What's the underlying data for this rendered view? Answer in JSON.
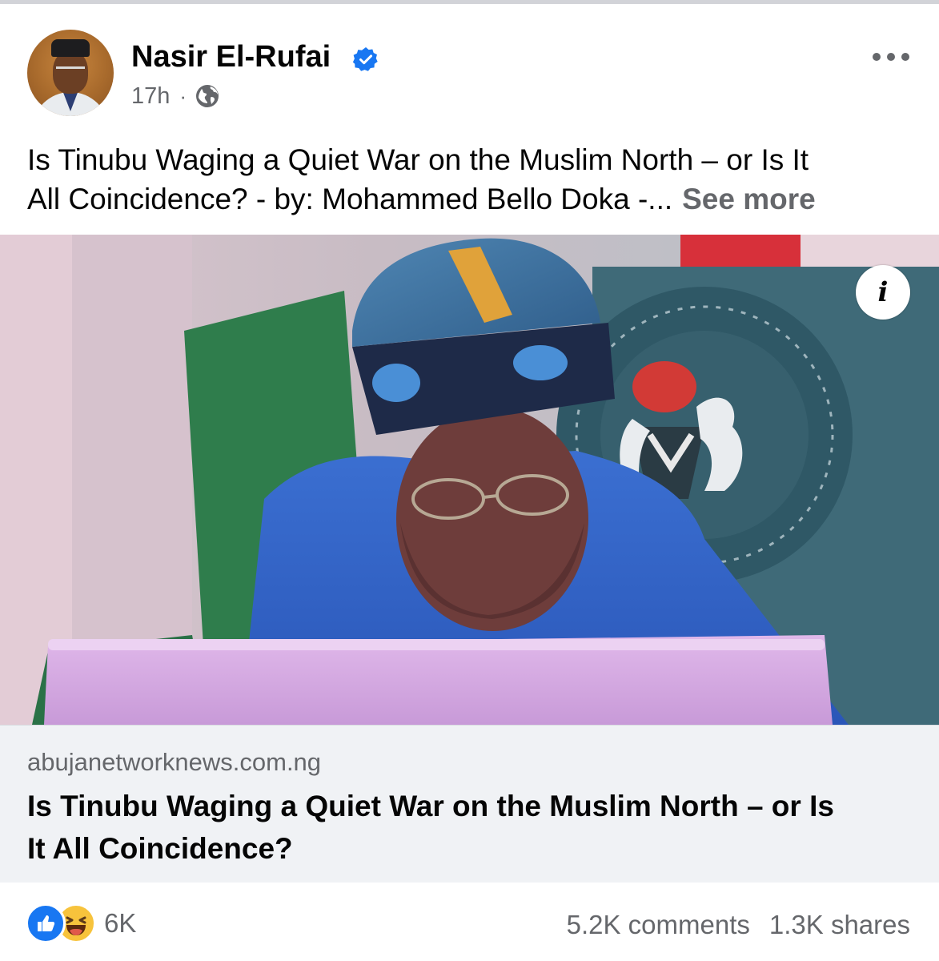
{
  "post": {
    "author_name": "Nasir El-Rufai",
    "verified": true,
    "timestamp": "17h",
    "separator": "·",
    "audience_icon": "globe-icon",
    "more_icon": "ellipsis-icon",
    "caption_line_1": "Is Tinubu Waging a Quiet War on the Muslim North – or Is It",
    "caption_line_2": "All Coincidence? - by: Mohammed Bello Doka -...",
    "see_more_label": "See more"
  },
  "media": {
    "info_label": "i",
    "info_icon": "info-icon"
  },
  "link_preview": {
    "domain": "abujanetworknews.com.ng",
    "title_line_1": "Is Tinubu Waging a Quiet War on the Muslim North – or Is",
    "title_line_2": "It All Coincidence?"
  },
  "engagement": {
    "reaction_icons": [
      "like-icon",
      "haha-icon"
    ],
    "reaction_count": "6K",
    "comments": "5.2K comments",
    "shares": "1.3K shares"
  },
  "colors": {
    "accent_blue": "#1877f2",
    "secondary_text": "#65676b",
    "link_bg": "#f0f2f5"
  }
}
